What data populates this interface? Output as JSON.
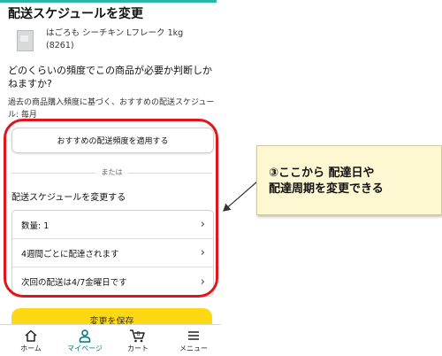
{
  "page": {
    "title": "配送スケジュールを変更",
    "product_name_line1": "はごろも シーチキン Lフレーク 1kg",
    "product_name_line2": "(8261)",
    "question": "どのくらいの頻度でこの商品が必要か判断しかねますか?",
    "recommend_note": "過去の商品購入頻度に基づく、おすすめの配送スケジュール: 毎月",
    "apply_button": "おすすめの配送頻度を適用する",
    "or_text": "または",
    "change_section_title": "配送スケジュールを変更する",
    "rows": [
      {
        "label": "数量: 1"
      },
      {
        "label": "4週間ごとに配達されます"
      },
      {
        "label": "次回の配送は4/7金曜日です"
      }
    ],
    "save_button": "変更を保存"
  },
  "nav": {
    "items": [
      {
        "label": "ホーム",
        "icon": "home-icon"
      },
      {
        "label": "マイページ",
        "icon": "person-icon",
        "active": true
      },
      {
        "label": "カート",
        "icon": "cart-icon",
        "badge": "0"
      },
      {
        "label": "メニュー",
        "icon": "menu-icon"
      }
    ]
  },
  "callout": {
    "line1": "③ここから 配達日や",
    "line2": "配達周期を変更できる"
  },
  "colors": {
    "accent": "#2bb7a8",
    "highlight": "#e0161c",
    "save_button": "#ffd814",
    "active_nav": "#007185",
    "callout_bg": "#fef8d2"
  }
}
